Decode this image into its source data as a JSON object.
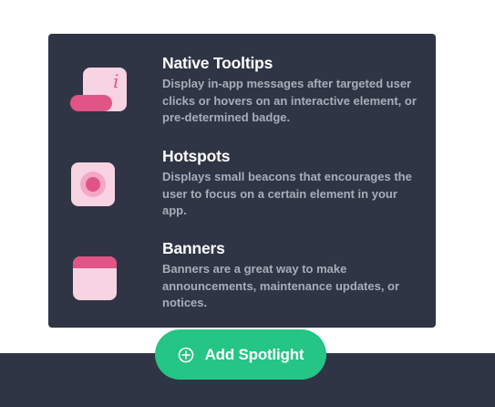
{
  "features": [
    {
      "title": "Native Tooltips",
      "description": "Display in-app messages after targeted user clicks or hovers on an interactive element, or pre-determined badge.",
      "icon": "tooltip-icon"
    },
    {
      "title": "Hotspots",
      "description": "Displays small beacons that encourages the user to focus on a certain element in your app.",
      "icon": "hotspot-icon"
    },
    {
      "title": "Banners",
      "description": "Banners are a great way to make announcements, maintenance updates, or notices.",
      "icon": "banner-icon"
    }
  ],
  "cta": {
    "label": "Add Spotlight",
    "icon": "plus-circle-icon"
  },
  "colors": {
    "card_bg": "#2f3544",
    "accent_green": "#24c585",
    "icon_light_pink": "#f8d3e2",
    "icon_pink": "#e05585",
    "text_white": "#ffffff",
    "text_muted": "#a7adb9"
  }
}
